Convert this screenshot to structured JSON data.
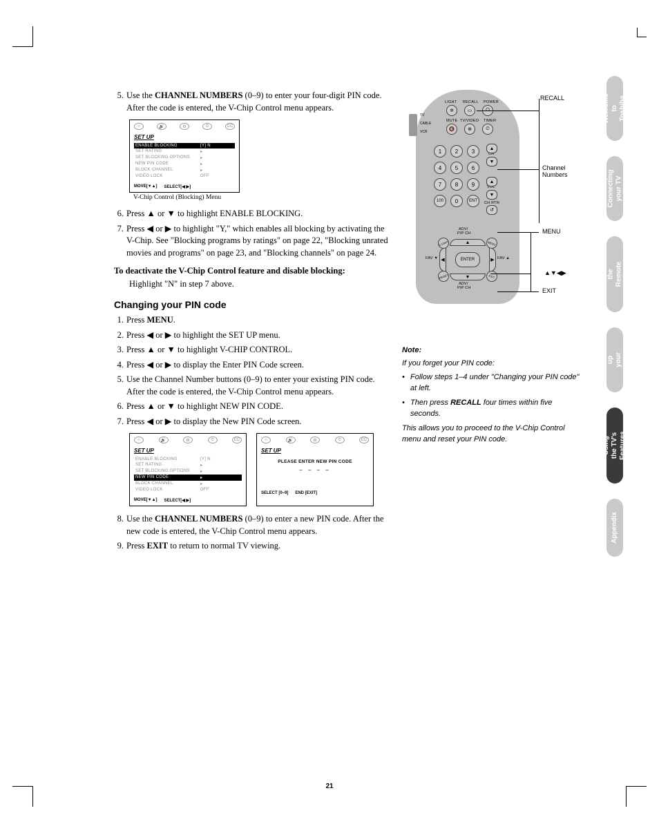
{
  "steps_a": {
    "s5": {
      "n": "5.",
      "pre": "Use the ",
      "bold": "CHANNEL NUMBERS",
      "post": " (0–9) to enter your four-digit PIN code. After the code is entered, the V-Chip Control menu appears."
    },
    "s6": {
      "n": "6.",
      "t": "Press ▲ or ▼ to highlight ENABLE BLOCKING."
    },
    "s7": {
      "n": "7.",
      "t": "Press ◀ or ▶ to highlight \"Y,\" which enables all blocking by activating the V-Chip. See \"Blocking programs by ratings\" on page 22, \"Blocking unrated movies and programs\" on page 23, and \"Blocking channels\" on page 24."
    }
  },
  "deactivate_heading": "To deactivate the V-Chip Control feature and disable blocking:",
  "deactivate_line": "Highlight \"N\" in step 7 above.",
  "heading_change": "Changing your PIN code",
  "steps_b": {
    "s1": {
      "n": "1.",
      "pre": "Press ",
      "bold": "MENU",
      "post": "."
    },
    "s2": {
      "n": "2.",
      "t": "Press ◀ or ▶ to highlight the SET UP menu."
    },
    "s3": {
      "n": "3.",
      "t": "Press ▲ or ▼ to highlight V-CHIP CONTROL."
    },
    "s4": {
      "n": "4.",
      "t": "Press ◀ or ▶ to display the Enter PIN Code screen."
    },
    "s5": {
      "n": "5.",
      "t": "Use the Channel Number buttons (0–9) to enter your existing PIN code. After the code is entered, the V-Chip Control menu appears."
    },
    "s6": {
      "n": "6.",
      "t": "Press ▲ or ▼ to highlight NEW PIN CODE."
    },
    "s7": {
      "n": "7.",
      "t": "Press ◀ or ▶ to display the New PIN Code screen."
    },
    "s8": {
      "n": "8.",
      "pre": "Use the ",
      "bold": "CHANNEL NUMBERS",
      "post": " (0–9) to enter a new PIN code. After the new code is entered, the V-Chip Control menu appears."
    },
    "s9": {
      "n": "9.",
      "pre": "Press ",
      "bold": "EXIT",
      "post": " to return to normal TV viewing."
    }
  },
  "osd1": {
    "title": "SET UP",
    "rows": {
      "r1": {
        "k": "ENABLE BLOCKING",
        "v": "[Y] N"
      },
      "r2": {
        "k": "SET RATING",
        "v": "▸"
      },
      "r3": {
        "k": "SET BLOCKING OPTIONS",
        "v": "▸"
      },
      "r4": {
        "k": "NEW PIN CODE",
        "v": "▸"
      },
      "r5": {
        "k": "BLOCK CHANNEL",
        "v": "▸"
      },
      "r6": {
        "k": "VIDEO LOCK",
        "v": "OFF"
      }
    },
    "footer1": "MOVE[▼▲]",
    "footer2": "SELECT[◀ ▶]",
    "caption": "V-Chip Control (Blocking) Menu"
  },
  "osd2": {
    "title": "SET UP",
    "rows": {
      "r1": {
        "k": "ENABLE BLOCKING",
        "v": "[Y] N"
      },
      "r2": {
        "k": "SET RATING",
        "v": "▸"
      },
      "r3": {
        "k": "SET BLOCKING OPTIONS",
        "v": "▸"
      },
      "r4": {
        "k": "NEW PIN CODE",
        "v": "▸"
      },
      "r5": {
        "k": "BLOCK CHANNEL",
        "v": "▸"
      },
      "r6": {
        "k": "VIDEO LOCK",
        "v": "OFF"
      }
    },
    "footer1": "MOVE[▼▲]",
    "footer2": "SELECT[◀ ▶]"
  },
  "osd3": {
    "title": "SET UP",
    "line1": "PLEASE ENTER NEW PIN CODE",
    "line2": "– – – –",
    "footer1": "SELECT [0–9]",
    "footer2": "END [EXIT]"
  },
  "osd_icons": {
    "cc": "CC"
  },
  "remote": {
    "sw": {
      "tv": "TV",
      "cable": "CABLE",
      "vcr": "VCR"
    },
    "top": {
      "light": "LIGHT",
      "recall": "RECALL",
      "power": "POWER",
      "mute": "MUTE",
      "tvvideo": "TV/VIDEO",
      "timer": "TIMER"
    },
    "nums": {
      "n1": "1",
      "n2": "2",
      "n3": "3",
      "n4": "4",
      "n5": "5",
      "n6": "6",
      "n7": "7",
      "n8": "8",
      "n9": "9",
      "n100": "100",
      "n0": "0",
      "ent": "ENT"
    },
    "side": {
      "ch": "CH",
      "vol": "VOL",
      "chrtn": "CH RTN"
    },
    "dpad": {
      "advt": "ADV/",
      "pipch": "PIP CH",
      "cc": "C.CAPT",
      "menu": "MENU",
      "reset": "RESET",
      "exit": "EXIT",
      "enter": "ENTER",
      "favl": "FAV ▼",
      "favr": "FAV ▲"
    }
  },
  "callouts": {
    "recall": "RECALL",
    "chnum": "Channel\nNumbers",
    "menu": "MENU",
    "arrows": "▲▼◀▶",
    "exit": "EXIT"
  },
  "note": {
    "heading": "Note:",
    "intro": "If you forget your PIN code:",
    "b1": "Follow steps 1–4 under \"Changing your PIN code\" at left.",
    "b2pre": "Then press ",
    "b2bold": "RECALL",
    "b2post": " four times within five seconds.",
    "outro": "This allows you to proceed to the V-Chip Control menu and reset your PIN code."
  },
  "tabs": {
    "t1": "Welcome to\nToshiba",
    "t2": "Connecting\nyour TV",
    "t3": "Using the\nRemote Control",
    "t4": "Setting up\nyour TV",
    "t5": "Using the TV's\nFeatures",
    "t6": "Appendix"
  },
  "page_number": "21"
}
